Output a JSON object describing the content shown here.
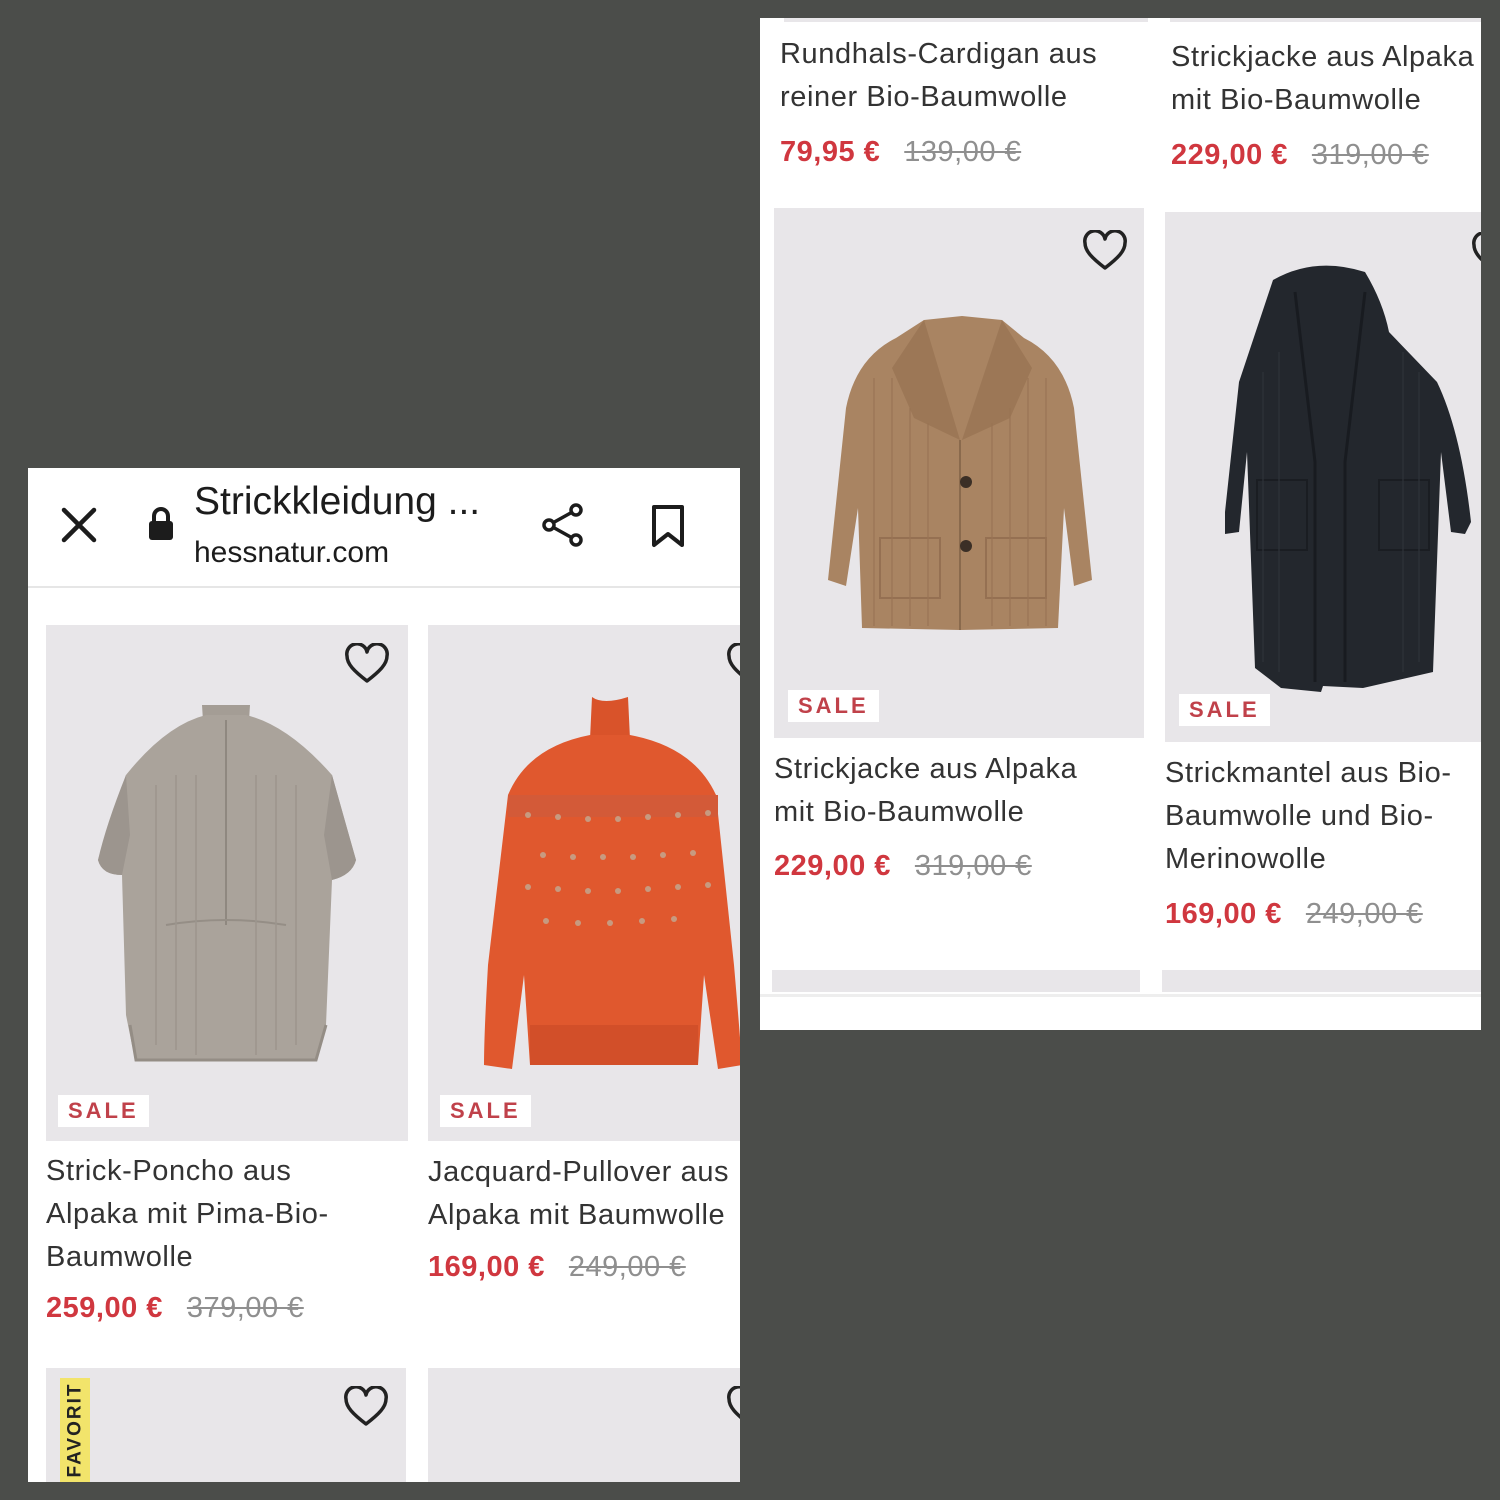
{
  "browser": {
    "title": "Strickkleidung ...",
    "url": "hessnatur.com",
    "icons": [
      "close-icon",
      "lock-icon",
      "share-icon",
      "bookmark-icon"
    ]
  },
  "left_products": [
    {
      "name": "Strick-Poncho aus\nAlpaka mit Pima-Bio-\nBaumwolle",
      "price": "259,00 €",
      "old_price": "379,00 €",
      "badge": "SALE"
    },
    {
      "name": "Jacquard-Pullover aus\nAlpaka mit Baumwolle",
      "price": "169,00 €",
      "old_price": "249,00 €",
      "badge": "SALE"
    }
  ],
  "favorit_badge": "FAVORIT",
  "right_top_products": [
    {
      "name": "Rundhals-Cardigan aus\nreiner Bio-Baumwolle",
      "price": "79,95 €",
      "old_price": "139,00 €"
    },
    {
      "name": "Strickjacke aus Alpaka\nmit Bio-Baumwolle",
      "price": "229,00 €",
      "old_price": "319,00 €"
    }
  ],
  "right_products": [
    {
      "name": "Strickjacke aus Alpaka\nmit Bio-Baumwolle",
      "price": "229,00 €",
      "old_price": "319,00 €",
      "badge": "SALE"
    },
    {
      "name": "Strickmantel aus Bio-\nBaumwolle und Bio-\nMerinowolle",
      "price": "169,00 €",
      "old_price": "249,00 €",
      "badge": "SALE"
    }
  ],
  "colors": {
    "sale_red": "#d0373f",
    "badge_red": "#c0414a",
    "favorit_yellow": "#f2e46b",
    "background": "#4b4d4a",
    "image_bg": "#e8e6e9"
  }
}
